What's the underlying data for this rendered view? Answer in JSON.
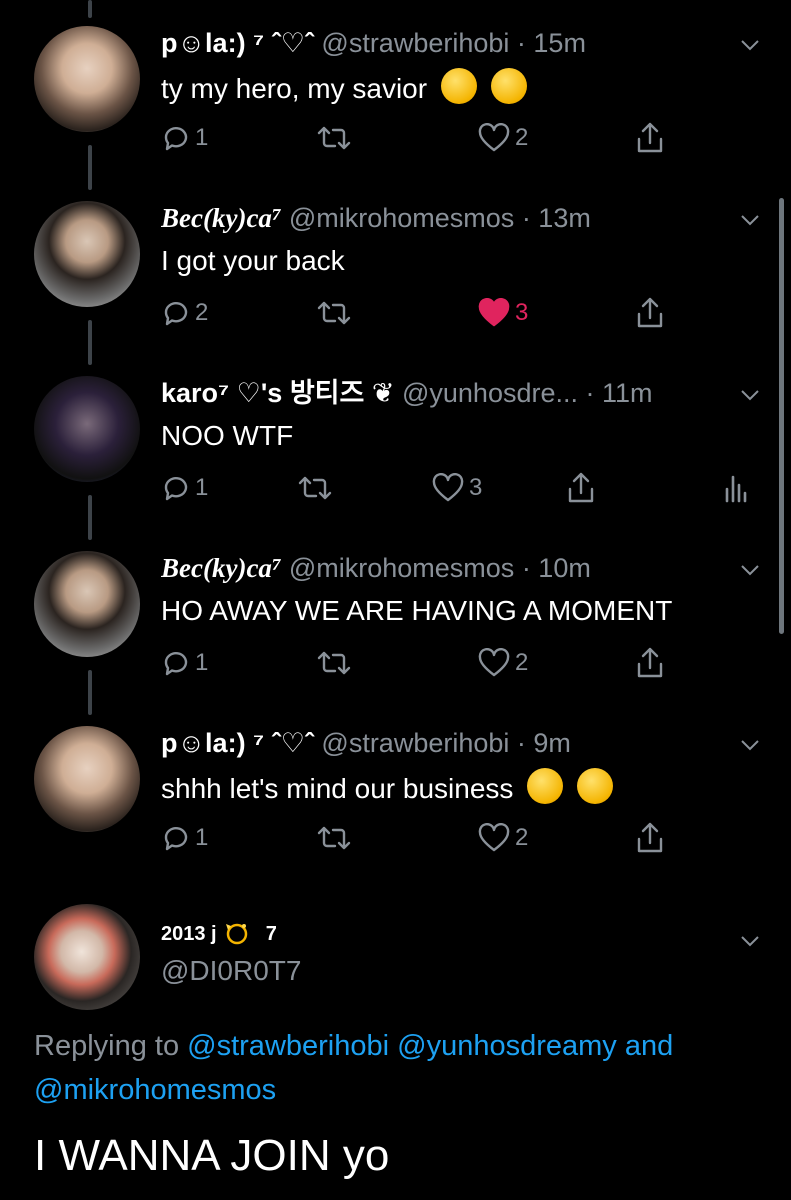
{
  "tweets": [
    {
      "name": "p☺la:) ⁷ ˆ♡ˆ",
      "handle": "@strawberihobi",
      "time": "· 15m",
      "text": "ty my hero, my savior",
      "emoji": [
        "kissing-face-closed-eyes",
        "raised-fist"
      ],
      "replies": "1",
      "retweets": "",
      "likes": "2",
      "liked": false
    },
    {
      "name": "Bec(ky)ca⁷",
      "handle": "@mikrohomesmos",
      "time": "· 13m",
      "text": "I got your back",
      "emoji": [],
      "replies": "2",
      "retweets": "",
      "likes": "3",
      "liked": true
    },
    {
      "name": "karo⁷ ♡'s 방티즈 ❦",
      "handle": "@yunhosdre...",
      "time": "· 11m",
      "text": "NOO WTF",
      "emoji": [],
      "replies": "1",
      "retweets": "",
      "likes": "3",
      "liked": false
    },
    {
      "name": "Bec(ky)ca⁷",
      "handle": "@mikrohomesmos",
      "time": "· 10m",
      "text": "HO AWAY WE ARE HAVING A MOMENT",
      "emoji": [],
      "replies": "1",
      "retweets": "",
      "likes": "2",
      "liked": false
    },
    {
      "name": "p☺la:) ⁷ ˆ♡ˆ",
      "handle": "@strawberihobi",
      "time": "· 9m",
      "text": "shhh let's mind our business",
      "emoji": [
        "relieved-face",
        "kissing-face-closed-eyes"
      ],
      "replies": "1",
      "retweets": "",
      "likes": "2",
      "liked": false
    }
  ],
  "focused": {
    "name": "2013 j",
    "name_emoji": "dizzy",
    "name_suffix": "7",
    "handle": "@DI0R0T7",
    "replying_prefix": "Replying to",
    "mention1": "@strawberihobi",
    "mention2": "@yunhosdreamy",
    "and": "and",
    "mention3": "@mikrohomesmos",
    "text": "I WANNA JOIN yo"
  },
  "colors": {
    "background": "#000000",
    "secondary_text": "#8a9199",
    "link": "#1da1f2",
    "like": "#e0245e"
  }
}
